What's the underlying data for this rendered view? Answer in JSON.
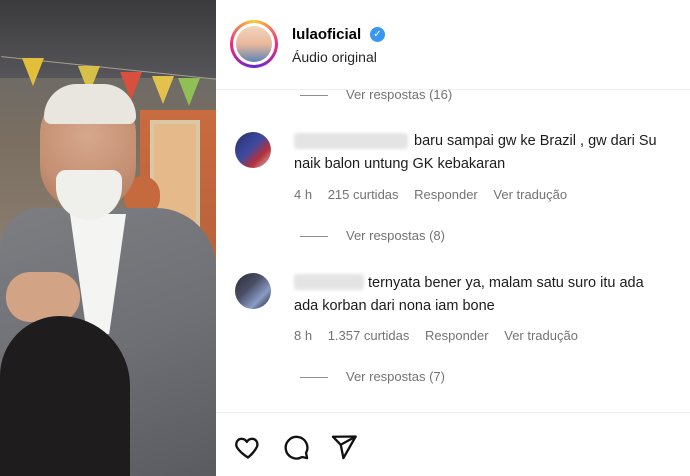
{
  "post": {
    "username": "lulaoficial",
    "verified": true,
    "audio_label": "Áudio original"
  },
  "thread_top": {
    "view_replies": "Ver respostas (16)"
  },
  "comments": [
    {
      "text_line1": "baru sampai gw ke Brazil , gw dari Su",
      "text_line2": "naik balon untung GK kebakaran",
      "time": "4 h",
      "likes": "215 curtidas",
      "reply": "Responder",
      "translate": "Ver tradução",
      "view_replies": "Ver respostas (8)"
    },
    {
      "text_line1": "ternyata bener ya, malam satu suro itu ada",
      "text_line2": "ada korban dari nona iam bone",
      "time": "8 h",
      "likes": "1.357 curtidas",
      "reply": "Responder",
      "translate": "Ver tradução",
      "view_replies": "Ver respostas (7)"
    }
  ],
  "actions": {
    "like_icon": "heart-icon",
    "comment_icon": "comment-icon",
    "share_icon": "send-icon"
  },
  "colors": {
    "verified": "#3897f0",
    "secondary_text": "#737373"
  }
}
